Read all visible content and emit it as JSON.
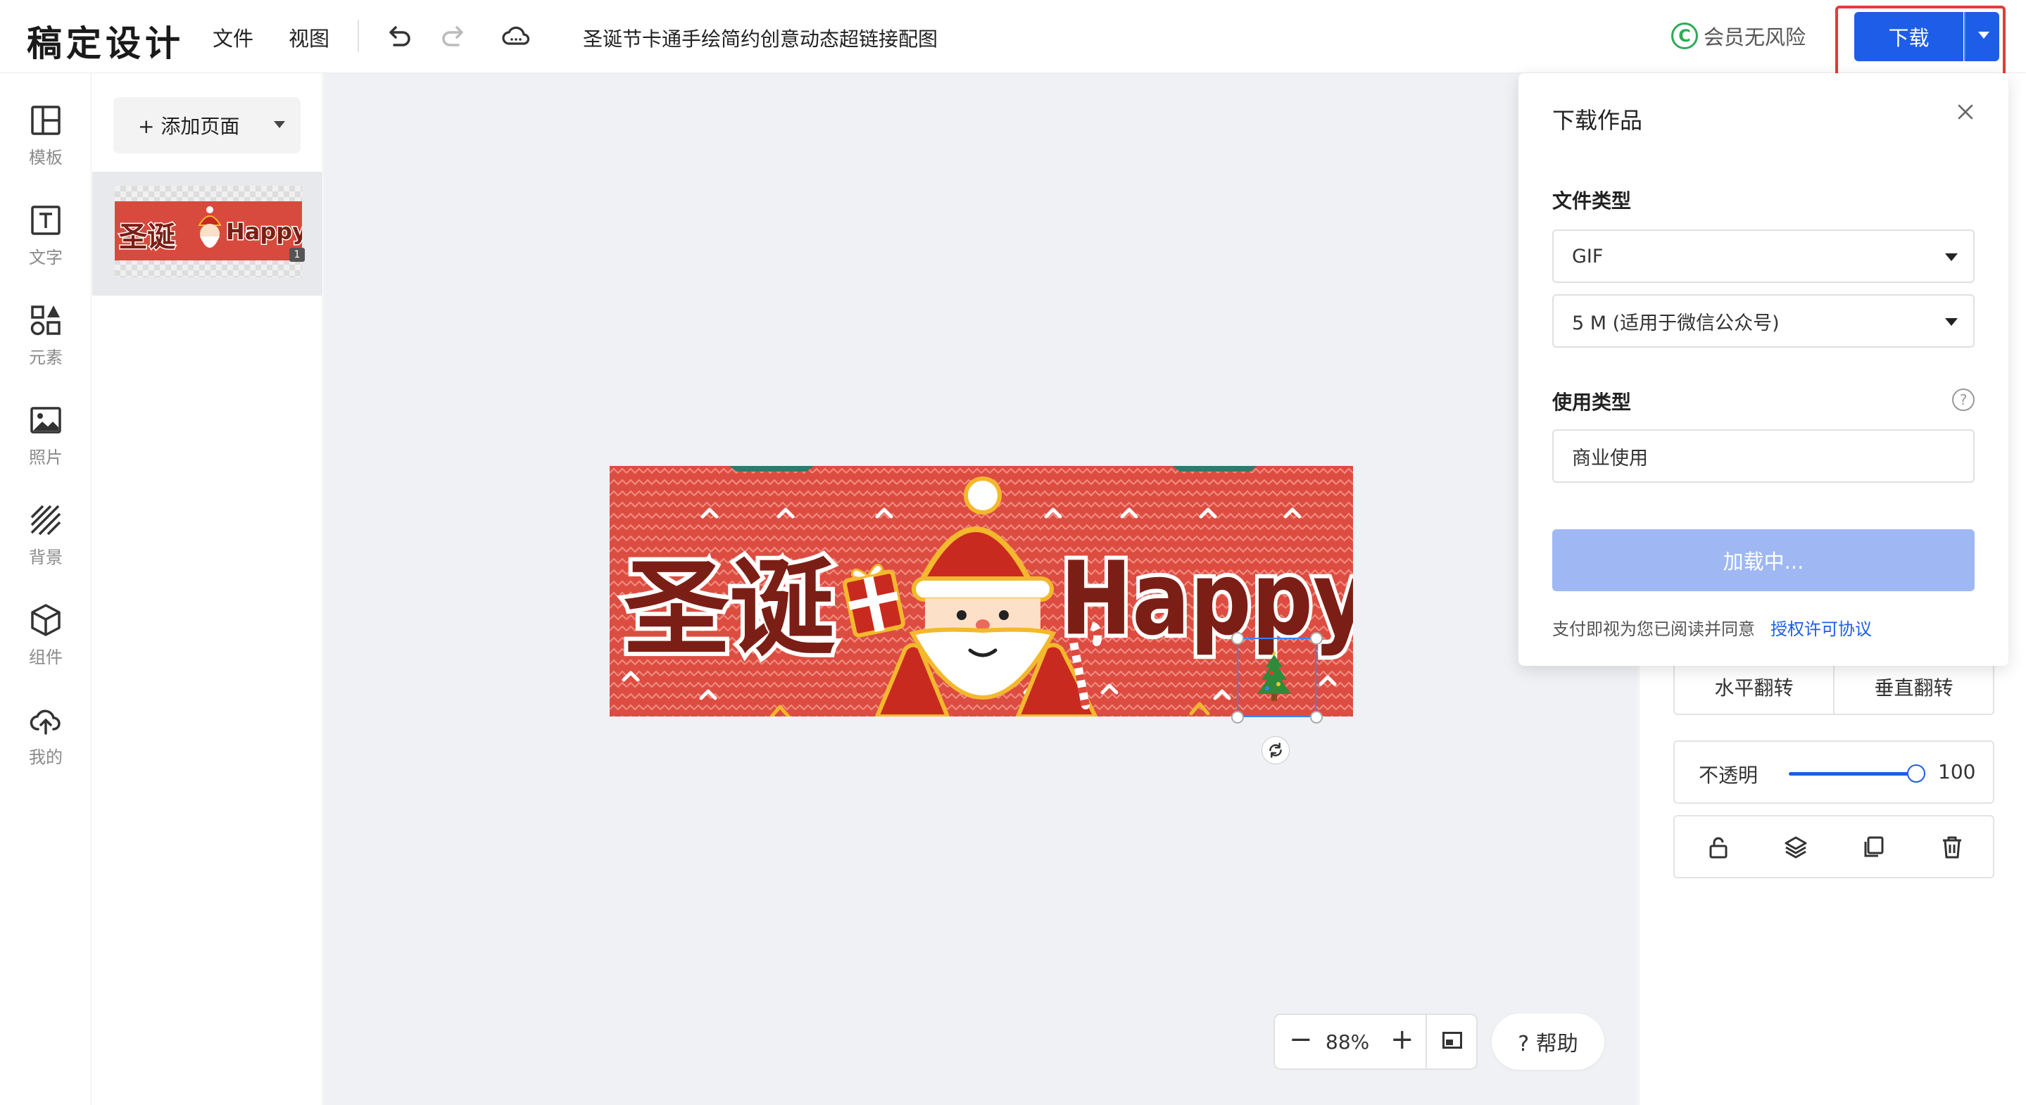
{
  "app": {
    "logo": "稿定设计",
    "menu": [
      "文件",
      "视图"
    ],
    "doc_title": "圣诞节卡通手绘简约创意动态超链接配图",
    "vip_label": "会员无风险",
    "download_label": "下载"
  },
  "rail": [
    {
      "label": "模板",
      "icon": "layout-icon"
    },
    {
      "label": "文字",
      "icon": "text-icon"
    },
    {
      "label": "元素",
      "icon": "shapes-icon"
    },
    {
      "label": "照片",
      "icon": "image-icon"
    },
    {
      "label": "背景",
      "icon": "stripes-icon"
    },
    {
      "label": "组件",
      "icon": "cube-icon"
    },
    {
      "label": "我的",
      "icon": "upload-cloud-icon"
    }
  ],
  "pages": {
    "add_label": "+ 添加页面",
    "page_number": "1"
  },
  "canvas": {
    "banner_text_cn": "圣诞",
    "banner_text_en": "Happy",
    "zoom": "88%",
    "help_label": "? 帮助"
  },
  "props": {
    "flip_h": "水平翻转",
    "flip_v": "垂直翻转",
    "opacity_label": "不透明",
    "opacity_value": "100"
  },
  "download_popup": {
    "title": "下载作品",
    "file_type_label": "文件类型",
    "file_type_value": "GIF",
    "size_value": "5 M (适用于微信公众号)",
    "usage_label": "使用类型",
    "usage_value": "商业使用",
    "confirm_label": "加载中...",
    "agree_text": "支付即视为您已阅读并同意",
    "agree_link": "授权许可协议"
  },
  "colors": {
    "accent": "#1d5de8",
    "banner_red": "#dd4c40",
    "highlight_box": "#e43a3a"
  }
}
